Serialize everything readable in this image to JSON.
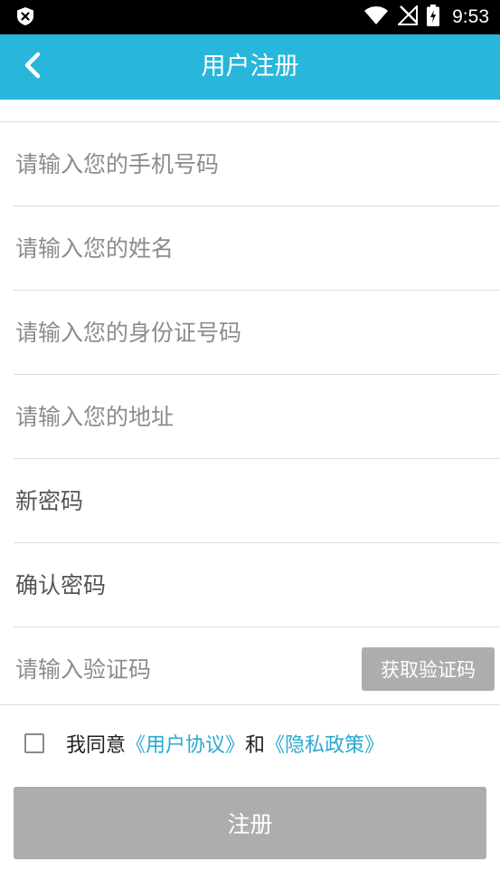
{
  "status_bar": {
    "time": "9:53",
    "icons": [
      "shield-close-icon",
      "wifi-icon",
      "no-signal-icon",
      "battery-charging-icon"
    ]
  },
  "header": {
    "title": "用户注册",
    "back_icon": "chevron-left-icon",
    "background_color": "#29b6db"
  },
  "form": {
    "phone_placeholder": "请输入您的手机号码",
    "name_placeholder": "请输入您的姓名",
    "id_placeholder": "请输入您的身份证号码",
    "address_placeholder": "请输入您的地址",
    "new_password_placeholder": "新密码",
    "confirm_password_placeholder": "确认密码",
    "code_placeholder": "请输入验证码",
    "get_code_label": "获取验证码"
  },
  "agreement": {
    "prefix": "我同意",
    "user_agreement": "《用户协议》",
    "and": "和",
    "privacy_policy": "《隐私政策》",
    "link_color": "#29a9d2"
  },
  "register_label": "注册"
}
